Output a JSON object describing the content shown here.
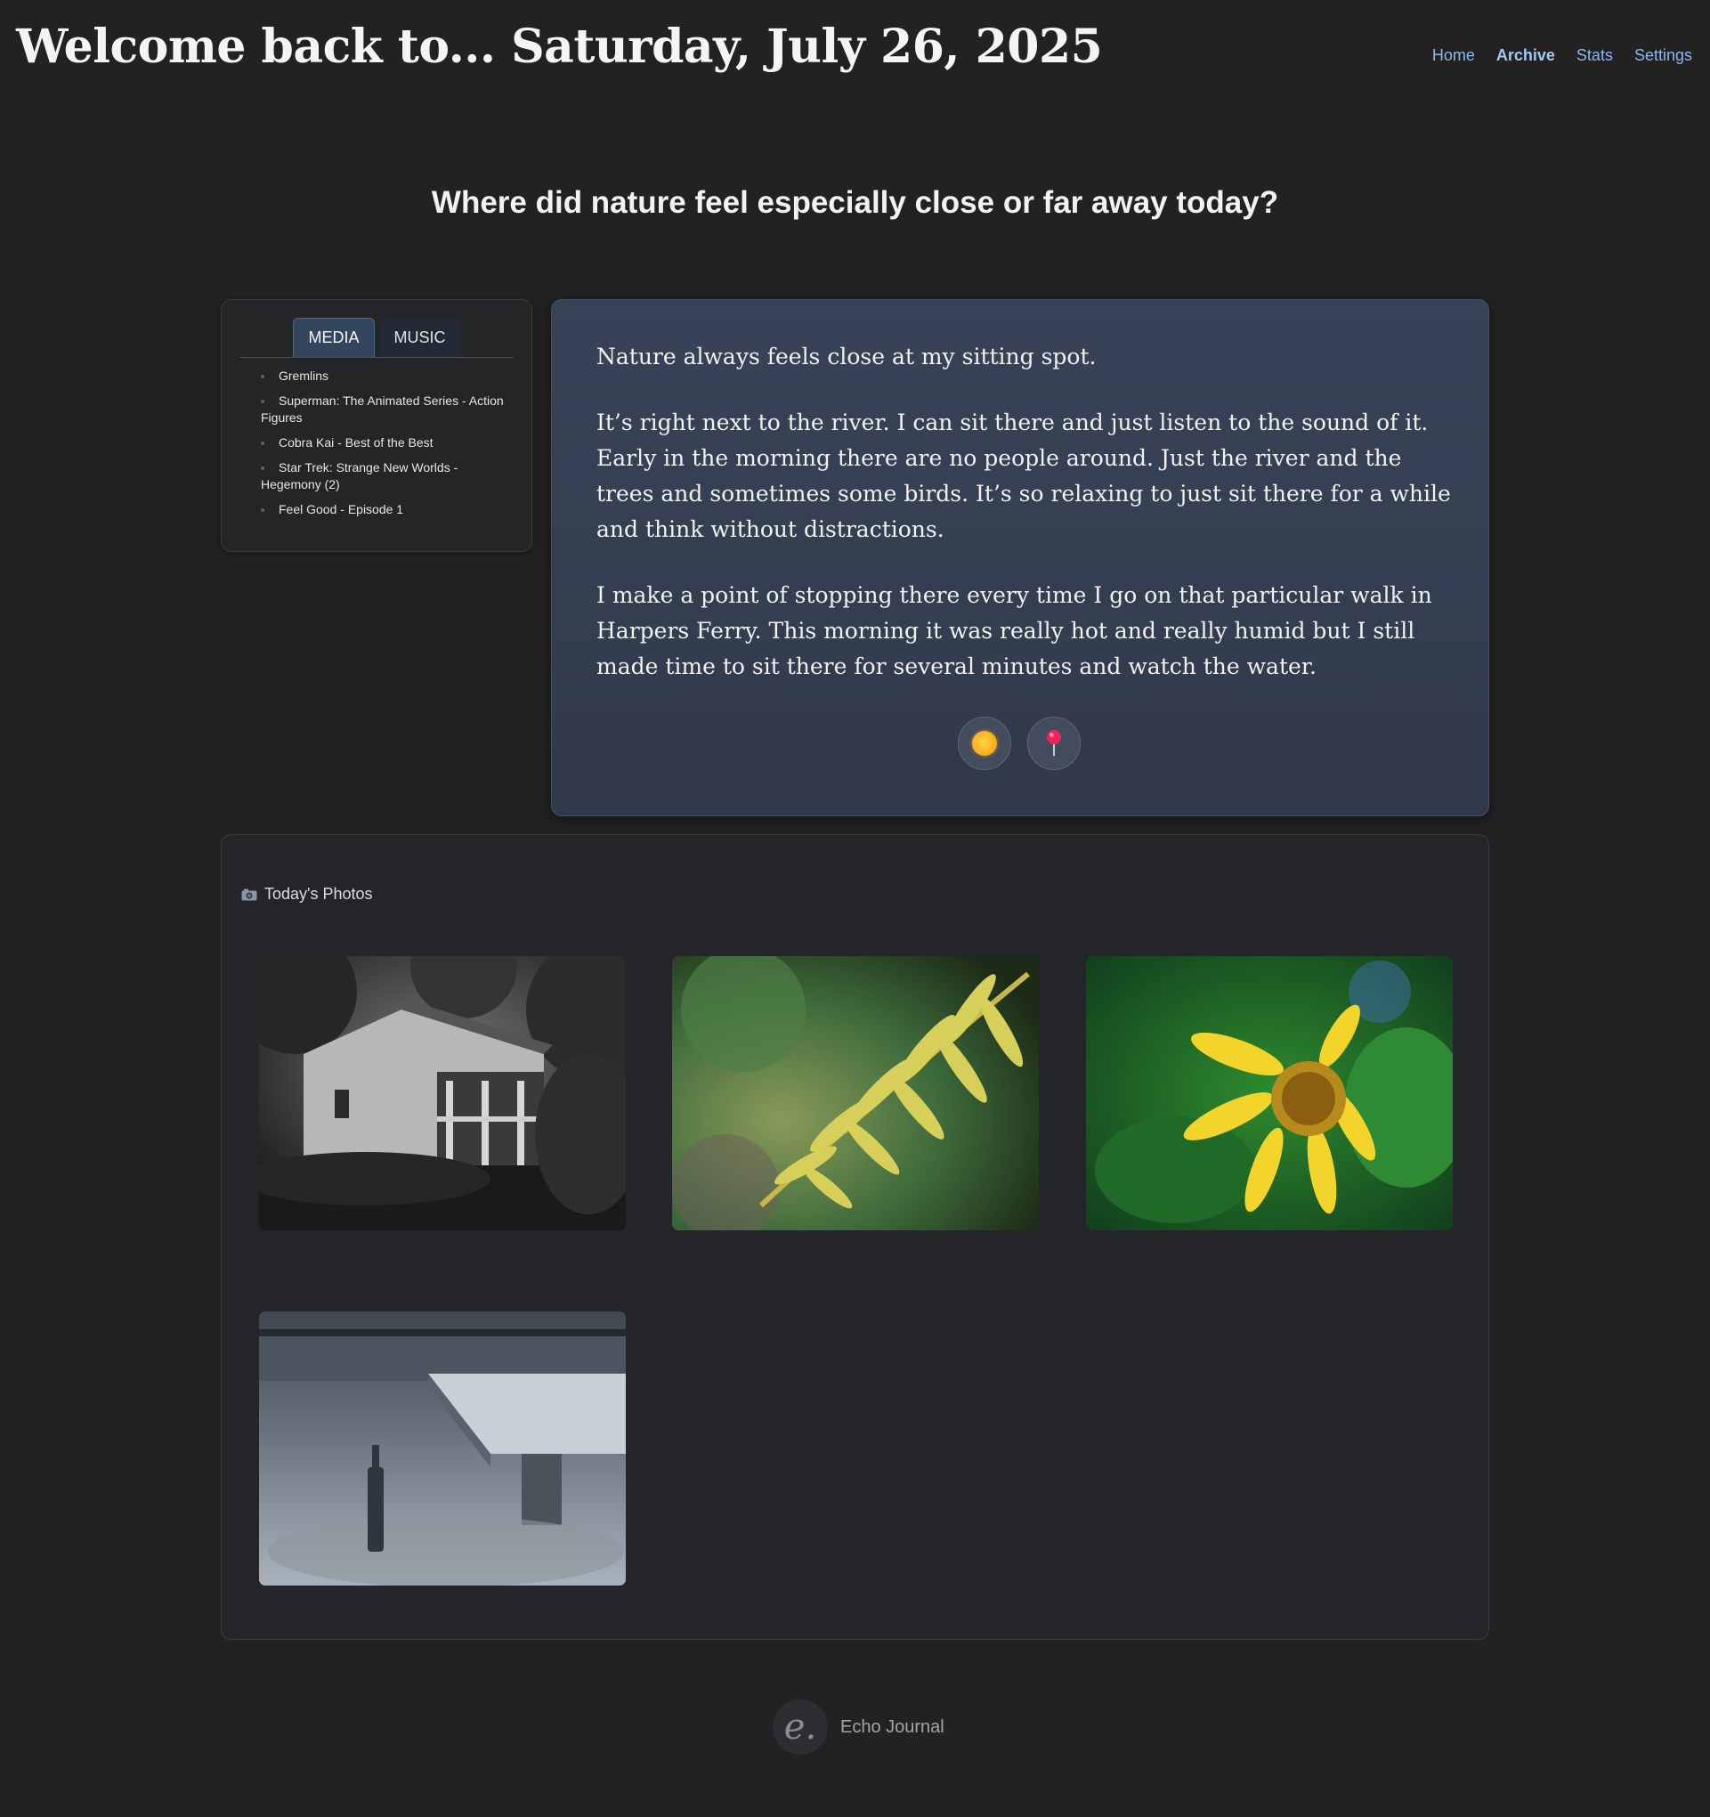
{
  "header": {
    "title": "Welcome back to... Saturday, July 26, 2025",
    "nav": [
      "Home",
      "Archive",
      "Stats",
      "Settings"
    ]
  },
  "prompt": "Where did nature feel especially close or far away today?",
  "media_panel": {
    "tabs": [
      "MEDIA",
      "MUSIC"
    ],
    "active_tab": "MEDIA",
    "items": [
      "Gremlins",
      "Superman: The Animated Series - Action Figures",
      "Cobra Kai - Best of the Best",
      "Star Trek: Strange New Worlds - Hegemony (2)",
      "Feel Good - Episode 1"
    ]
  },
  "entry": {
    "paragraphs": [
      "Nature always feels close at my sitting spot.",
      "It’s right next to the river. I can sit there and just listen to the sound of it. Early in the morning there are no people around. Just the river and the trees and sometimes some birds. It’s so relaxing to just sit there for a while and think without distractions.",
      "I make a point of stopping there every time I go on that particular walk in Harpers Ferry. This morning it was really hot and really humid but I still made time to sit there for several minutes and watch the water."
    ],
    "actions": [
      "sun-icon",
      "pin-icon"
    ]
  },
  "photos": {
    "title": "Today's Photos",
    "icon": "camera-icon",
    "items": [
      "old-house-photo",
      "fern-photo",
      "yellow-flower-photo",
      "bench-bottle-photo"
    ]
  },
  "footer": {
    "logo_letter": "e.",
    "name": "Echo Journal"
  },
  "colors": {
    "background": "#222222",
    "link": "#8ab8f0",
    "entry_card": "#384357"
  }
}
